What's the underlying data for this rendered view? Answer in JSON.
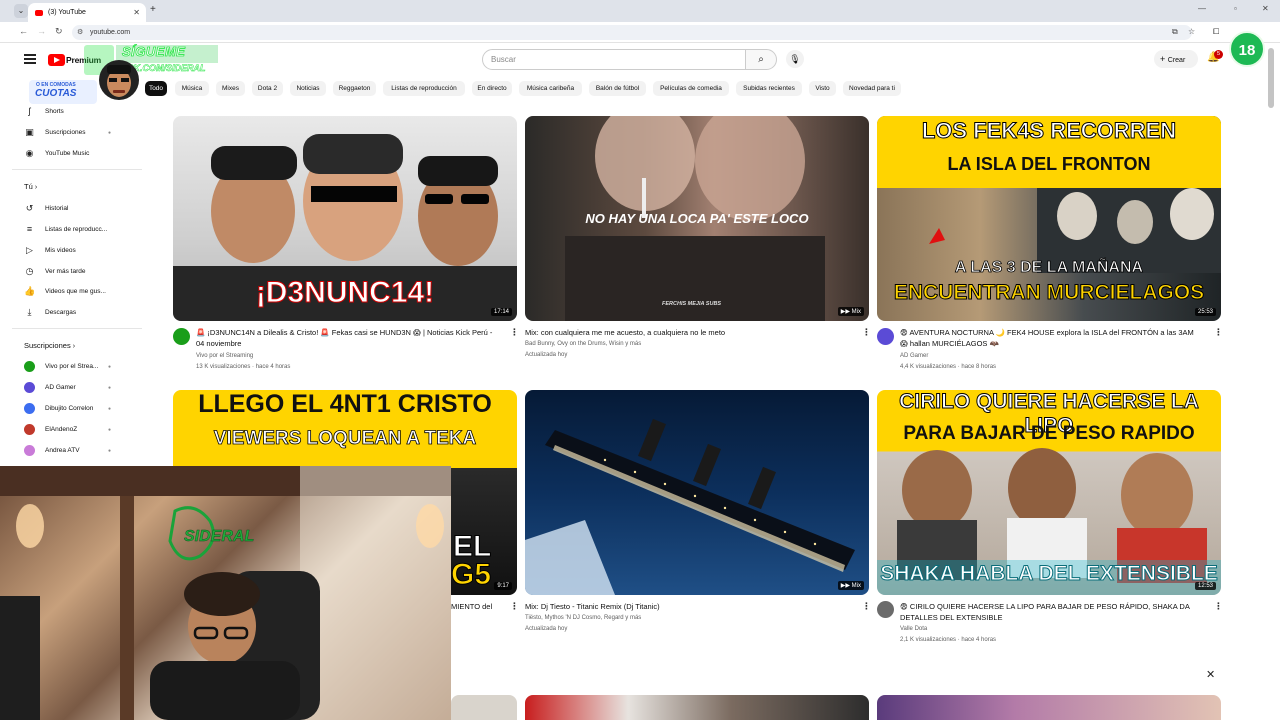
{
  "browser": {
    "tab_title": "(3) YouTube",
    "tab_menu_icon": "chevron-down-icon",
    "new_tab_label": "+",
    "url": "youtube.com"
  },
  "header": {
    "logo_text": "Premium",
    "search_placeholder": "Buscar",
    "create_label": "Crear",
    "notifications_count": "5",
    "age_badge": "18"
  },
  "overlay": {
    "follow_title": "SÍGUEME",
    "follow_handle": "KICK.COM/SIDERAL",
    "sponsor_top": "O EN COMODAS",
    "sponsor_main": "CUOTAS",
    "webcam_logo": "SIDERAL"
  },
  "sidebar": {
    "top_items": [
      {
        "label": "Shorts",
        "icon": "shorts-icon"
      },
      {
        "label": "Suscripciones",
        "icon": "subscriptions-icon"
      },
      {
        "label": "YouTube Music",
        "icon": "music-icon"
      }
    ],
    "you_heading": "Tú",
    "you_items": [
      {
        "label": "Historial",
        "icon": "history-icon"
      },
      {
        "label": "Listas de reproducc...",
        "icon": "playlist-icon"
      },
      {
        "label": "Mis videos",
        "icon": "my-videos-icon"
      },
      {
        "label": "Ver más tarde",
        "icon": "watch-later-icon"
      },
      {
        "label": "Videos que me gus...",
        "icon": "like-icon"
      },
      {
        "label": "Descargas",
        "icon": "download-icon"
      }
    ],
    "subs_heading": "Suscripciones",
    "subs": [
      {
        "label": "Vivo por el Strea...",
        "color": "#1a9e1a"
      },
      {
        "label": "AD Gamer",
        "color": "#5b4bd6"
      },
      {
        "label": "Dibujito Correlon",
        "color": "#3c6df0"
      },
      {
        "label": "ElAndenoZ",
        "color": "#c0392b"
      },
      {
        "label": "Andrea ATV",
        "color": "#c97bd8"
      }
    ]
  },
  "chips": [
    "Todo",
    "Música",
    "Mixes",
    "Dota 2",
    "Noticias",
    "Reggaeton",
    "Listas de reproducción",
    "En directo",
    "Música caribeña",
    "Balón de fútbol",
    "Películas de comedia",
    "Subidas recientes",
    "Visto",
    "Novedad para ti"
  ],
  "videos": [
    {
      "title_l1": "🚨 ¡D3NUNC14N a Dilealis & Cristo! 🚨 Fekas casi se HUND3N 😱 | Noticias Kick Perú -",
      "title_l2": "04 noviembre",
      "channel": "Vivo por el Streaming",
      "stats": "13 K visualizaciones · hace 4 horas",
      "duration": "17:14",
      "thumb_text": "¡D3NUNC14!"
    },
    {
      "title_l1": "Mix: con cualquiera me me acuesto, a cualquiera no le meto",
      "title_l2": "",
      "channel": "Bad Bunny, Ovy on the Drums, Wisin y más",
      "stats": "Actualizada hoy",
      "duration": "Mix",
      "thumb_text": "NO HAY UNA LOCA PA' ESTE LOCO",
      "thumb_sub": "FERCHIS MEJIA SUBS"
    },
    {
      "title_l1": "😨 AVENTURA NOCTURNA 🌙 FEK4 HOUSE explora la ISLA del FRONTÓN a las 3AM",
      "title_l2": "😱 hallan MURCIÉLAGOS 🦇",
      "channel": "AD Gamer",
      "stats": "4,4 K visualizaciones · hace 8 horas",
      "duration": "25:53",
      "thumb_top1": "LOS FEK4S RECORREN",
      "thumb_top2": "LA ISLA DEL FRONTON",
      "thumb_bot1": "A LAS 3 DE LA MAÑANA",
      "thumb_bot2": "ENCUENTRAN MURCIELAGOS"
    },
    {
      "title_l1": "MIENTO del",
      "title_l2": "",
      "channel": "",
      "stats": "",
      "duration": "9:17",
      "thumb_top1": "LLEGO EL 4NT1 CRISTO",
      "thumb_top2": "VIEWERS LOQUEAN A TEKA",
      "thumb_side1": "EL",
      "thumb_side2": "G5"
    },
    {
      "title_l1": "Mix: Dj Tiesto - Titanic  Remix (Dj Titanic)",
      "title_l2": "",
      "channel": "Tiësto, Mythos 'N DJ Cosmo, Regard y más",
      "stats": "Actualizada hoy",
      "duration": "Mix"
    },
    {
      "title_l1": "😨 CIRILO QUIERE HACERSE LA LIPO PARA BAJAR DE PESO RÁPIDO, SHAKA DA",
      "title_l2": "DETALLES DEL EXTENSIBLE",
      "channel": "Valle Dota",
      "stats": "2,1 K visualizaciones · hace 4 horas",
      "duration": "12:53",
      "thumb_top1": "CIRILO QUIERE HACERSE LA LIPO",
      "thumb_top2": "PARA BAJAR DE PESO RAPIDO",
      "thumb_bot1": "SHAKA HABLA DEL EXTENSIBLE"
    }
  ],
  "colors": {
    "brand_red": "#ff0000",
    "neon_green": "#2ee64a",
    "thumb_yellow": "#ffd400"
  }
}
